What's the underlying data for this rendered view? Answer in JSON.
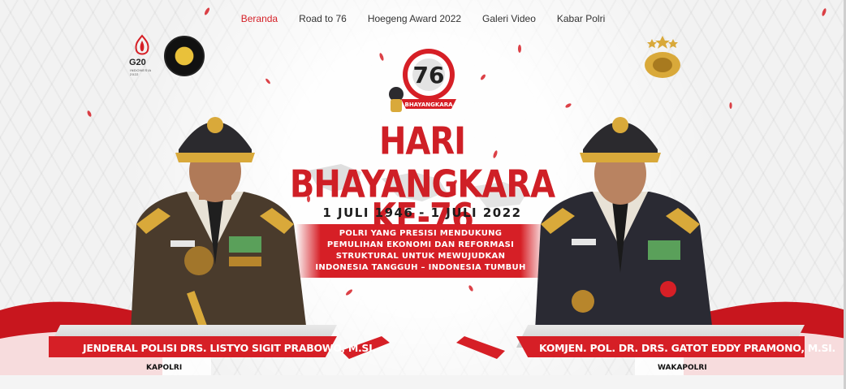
{
  "nav": {
    "items": [
      {
        "label": "Beranda",
        "active": true
      },
      {
        "label": "Road to 76",
        "active": false
      },
      {
        "label": "Hoegeng Award 2022",
        "active": false
      },
      {
        "label": "Galeri Video",
        "active": false
      },
      {
        "label": "Kabar Polri",
        "active": false
      }
    ]
  },
  "logos": {
    "g20_text": "G20",
    "g20_sub": "INDONESIA 2022",
    "emblem_number": "76",
    "emblem_ribbon": "BHAYANGKARA"
  },
  "hero": {
    "title_line1": "HARI BHAYANGKARA",
    "title_line2": "KE-76",
    "dates": "1 JULI 1946 - 1 JULI 2022",
    "slogan": [
      "POLRI YANG PRESISI MENDUKUNG",
      "PEMULIHAN EKONOMI DAN REFORMASI",
      "STRUKTURAL UNTUK MEWUJUDKAN",
      "INDONESIA TANGGUH – INDONESIA TUMBUH"
    ]
  },
  "officials": [
    {
      "name": "JENDERAL POLISI DRS. LISTYO SIGIT PRABOWO, M.SI.",
      "role": "KAPOLRI"
    },
    {
      "name": "KOMJEN. POL. DR. DRS. GATOT EDDY PRAMONO, M.SI.",
      "role": "WAKAPOLRI"
    }
  ],
  "colors": {
    "accent_red": "#d61f26",
    "gold": "#d9a93a",
    "uniform_dark": "#2b2a2e"
  }
}
